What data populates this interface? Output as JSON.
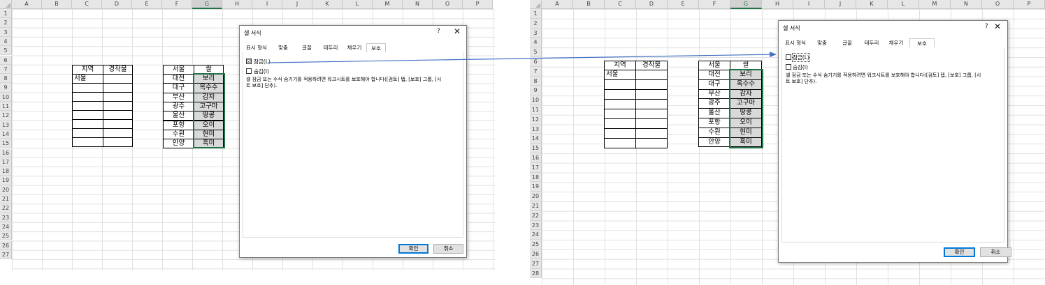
{
  "columns": [
    "A",
    "B",
    "C",
    "D",
    "E",
    "F",
    "G",
    "H",
    "I",
    "J",
    "K",
    "L",
    "M",
    "N",
    "O",
    "P"
  ],
  "left_rows": [
    "1",
    "2",
    "3",
    "4",
    "5",
    "6",
    "7",
    "8",
    "9",
    "10",
    "11",
    "12",
    "13",
    "14",
    "15",
    "16",
    "17",
    "18",
    "19",
    "20",
    "21",
    "22",
    "23",
    "24",
    "25",
    "26",
    "27"
  ],
  "right_rows": [
    "1",
    "2",
    "3",
    "4",
    "5",
    "6",
    "7",
    "8",
    "9",
    "10",
    "11",
    "12",
    "13",
    "14",
    "15",
    "16",
    "17",
    "18",
    "19",
    "20",
    "21",
    "22",
    "23",
    "24",
    "25",
    "26",
    "27",
    "28"
  ],
  "table1": {
    "headers": [
      "지역",
      "경작물"
    ],
    "first_value": "서울"
  },
  "table2": {
    "header_city": "서울",
    "header_crop": "쌀",
    "cities": [
      "대전",
      "대구",
      "부산",
      "광주",
      "울산",
      "포항",
      "수원",
      "안양"
    ],
    "crops": [
      "보리",
      "옥수수",
      "감자",
      "고구마",
      "땅콩",
      "오이",
      "현미",
      "흑미"
    ]
  },
  "dialog": {
    "title": "셀 서식",
    "help": "?",
    "close": "✕",
    "tabs": [
      "표시 형식",
      "맞춤",
      "글꼴",
      "테두리",
      "채우기",
      "보호"
    ],
    "active_tab": "보호",
    "lock_label": "잠금(L)",
    "hide_label": "숨김(I)",
    "description_line1": "셀 잠금 또는 수식 숨기기를 적용하려면 워크시트를 보호해야 합니다([검토] 탭, [보호] 그룹, [시",
    "description_line2": "트 보호] 단추).",
    "ok": "확인",
    "cancel": "취소"
  },
  "left_state": {
    "lock_checked": "☑",
    "hide_checked": ""
  },
  "right_state": {
    "lock_checked": "",
    "hide_checked": ""
  },
  "colors": {
    "selection": "#217346",
    "arrow": "#4472c4",
    "gray_fill": "#d9d9d9"
  }
}
